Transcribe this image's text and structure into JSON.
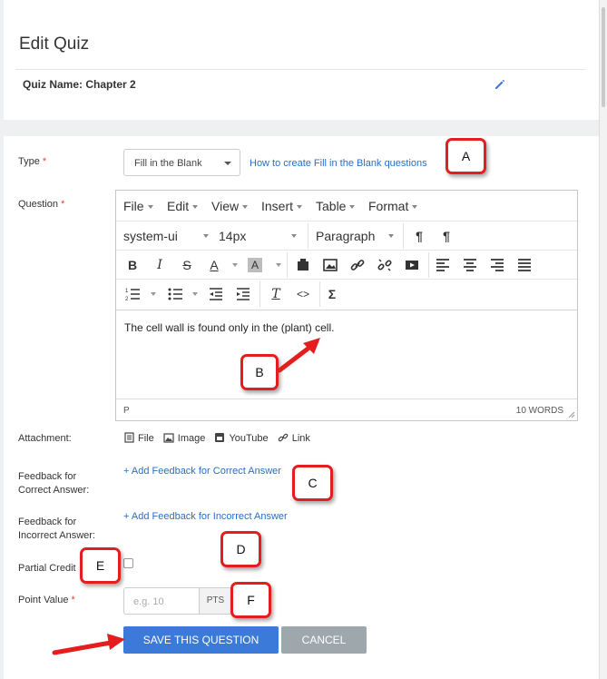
{
  "header": {
    "title": "Edit Quiz",
    "quiz_name": "Quiz Name: Chapter 2"
  },
  "form": {
    "type": {
      "label": "Type",
      "required_mark": "*",
      "selected": "Fill in the Blank",
      "help_link": "How to create Fill in the Blank questions"
    },
    "question": {
      "label": "Question",
      "required_mark": "*"
    },
    "editor": {
      "menu": [
        "File",
        "Edit",
        "View",
        "Insert",
        "Table",
        "Format"
      ],
      "font_family": "system-ui",
      "font_size": "14px",
      "block_format": "Paragraph",
      "content": "The cell wall is found only in the (plant) cell.",
      "status_path": "P",
      "word_count": "10 WORDS"
    },
    "attachment": {
      "label": "Attachment:",
      "items": [
        "File",
        "Image",
        "YouTube",
        "Link"
      ]
    },
    "feedback_correct": {
      "label_line1": "Feedback for",
      "label_line2": "Correct Answer:",
      "link": "+ Add Feedback for Correct Answer"
    },
    "feedback_incorrect": {
      "label_line1": "Feedback for",
      "label_line2": "Incorrect Answer:",
      "link": "+ Add Feedback for Incorrect Answer"
    },
    "partial_credit": {
      "label": "Partial Credit"
    },
    "point_value": {
      "label": "Point Value",
      "required_mark": "*",
      "placeholder": "e.g. 10",
      "addon": "PTS"
    },
    "buttons": {
      "save": "SAVE THIS QUESTION",
      "cancel": "CANCEL"
    }
  },
  "callouts": {
    "a": "A",
    "b": "B",
    "c": "C",
    "d": "D",
    "e": "E",
    "f": "F"
  },
  "colors": {
    "link": "#2b6fc4",
    "primary": "#3b7ad8",
    "cancel": "#9da7ac",
    "callout_border": "#e41e1e",
    "required": "#e0423c"
  }
}
